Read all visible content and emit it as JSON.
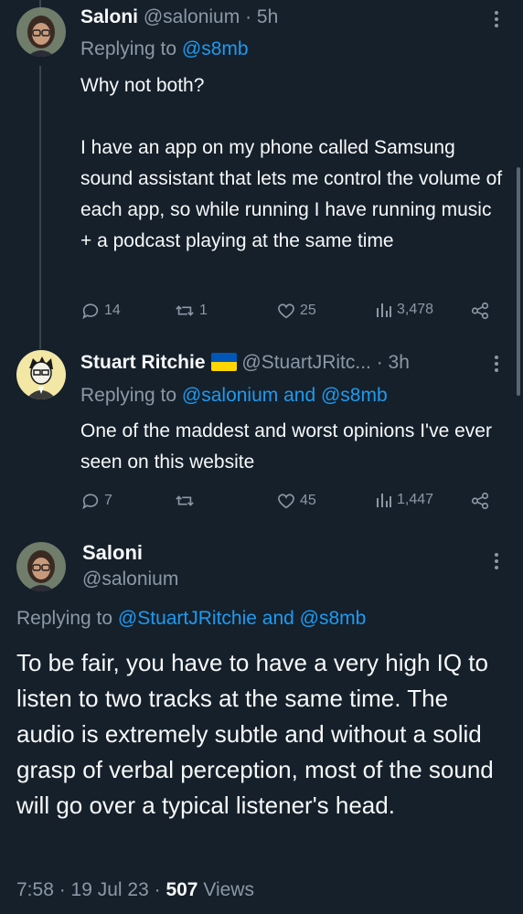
{
  "reply1": {
    "display_name": "Saloni",
    "handle": "@salonium",
    "time": "· 5h",
    "replying_prefix": "Replying to",
    "replying_to": "@s8mb",
    "text_p1": "Why not both?",
    "text_p2": "I have an app on my phone called Samsung sound assistant that lets me control the volume of each app, so while running I have running music + a podcast playing at the same time",
    "replies": "14",
    "retweets": "1",
    "likes": "25",
    "views": "3,478"
  },
  "reply2": {
    "display_name": "Stuart Ritchie",
    "handle": "@StuartJRitc...",
    "time": "· 3h",
    "replying_prefix": "Replying to",
    "replying_to": "@salonium and @s8mb",
    "text": "One of the maddest and worst opinions I've ever seen on this website",
    "replies": "7",
    "retweets": "",
    "likes": "45",
    "views": "1,447",
    "flag_colors": [
      "#0057b7",
      "#ffd700"
    ]
  },
  "main": {
    "display_name": "Saloni",
    "handle": "@salonium",
    "replying_prefix": "Replying to",
    "replying_to": "@StuartJRitchie and @s8mb",
    "text": "To be fair, you have to have a very high IQ to listen to two tracks at the same time. The audio is extremely subtle and without a solid grasp of verbal perception, most of the sound will go over a typical listener's head.",
    "timestamp": "7:58 · 19 Jul 23 ·",
    "views_count": "507",
    "views_label": "Views"
  },
  "colors": {
    "background": "#15202b",
    "link": "#1d9bf0",
    "muted": "#8b98a5"
  }
}
